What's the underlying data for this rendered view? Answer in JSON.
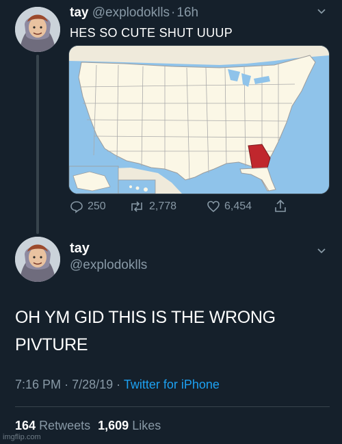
{
  "tweet1": {
    "name": "tay",
    "handle": "@explodoklls",
    "separator": "·",
    "time_ago": "16h",
    "text": "HES SO CUTE SHUT UUUP",
    "actions": {
      "replies": "250",
      "retweets": "2,778",
      "likes": "6,454"
    },
    "icons": [
      "reply-icon",
      "retweet-icon",
      "like-icon",
      "share-icon",
      "chevron-down-icon"
    ]
  },
  "tweet2": {
    "name": "tay",
    "handle": "@explodoklls",
    "text_line1": "OH YM GID THIS IS THE WRONG",
    "text_line2": "PIVTURE",
    "time": "7:16 PM",
    "date": "7/28/19",
    "sep": "·",
    "source": "Twitter for iPhone",
    "retweet_count": "164",
    "retweet_label": "Retweets",
    "like_count": "1,609",
    "like_label": "Likes"
  },
  "colors": {
    "background": "#15202b",
    "muted": "#8899a6",
    "link": "#1da1f2",
    "map_water": "#8fc3ea",
    "map_land": "#fbf7e6",
    "highlight_state": "#c0272d"
  },
  "watermark": "imgflip.com"
}
